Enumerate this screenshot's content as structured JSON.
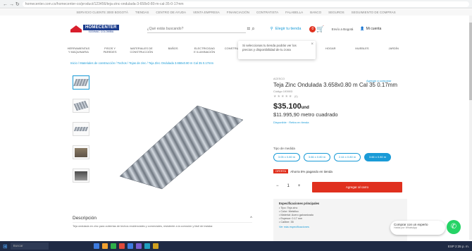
{
  "browser": {
    "url": "homecenter.com.co/homecenter-co/product/123456/teja-zinc-ondulada-3-658x0-80-m-cal-35-0-17mm",
    "nav_icons": "← → ↻"
  },
  "topstrip": {
    "items": [
      "SERVICIO CLIENTE 3000 BOGOTÁ",
      "TIENDAS",
      "CENTRO DE AYUDA",
      "VENTA EMPRESA",
      "FINANCIACIÓN",
      "CONTRATISTA",
      "FALABELLA",
      "BANCO",
      "SEGUROS",
      "SEGUIMIENTO DE COMPRAS"
    ]
  },
  "header": {
    "logo_brand": "HOMECENTER",
    "logo_sub": "SODIMAC COLOMBIA",
    "search_placeholder": "¿Qué estás buscando?",
    "store_label": "Elegir tu tienda",
    "cart_count": "0",
    "location": "Envío a Bogotá",
    "account_label": "Mi cuenta"
  },
  "tooltip": {
    "text": "Si seleccionas tu tienda podrás ver los precios y disponibilidad de tu zona",
    "close": "×"
  },
  "categories": [
    "HERRAMIENTAS Y MAQUINARIA",
    "PISOS Y PAREDES",
    "MATERIALES DE CONSTRUCCIÓN",
    "BAÑOS",
    "ELECTRICIDAD E ILUMINACIÓN",
    "CONSTRUCCIÓN",
    "DORMITORIO",
    "COCINA",
    "HOGAR",
    "MUEBLES",
    "JARDÍN",
    "DECORACIÓN"
  ],
  "breadcrumb": "Inicio / Materiales de construcción / Techos / Tejas de zinc / Teja Zinc Ondulada 3.658x0.80 m Cal 35 0.17mm",
  "product": {
    "brand": "ACESCO",
    "title": "Teja Zinc Ondulada 3.658x0.80 m Cal 35 0.17mm",
    "code": "Código 193903",
    "stars": "★★★★★",
    "review_count": "(0)",
    "price": "$35.100",
    "price_unit": "und",
    "price_m2": "$11.995,90 metro cuadrado",
    "availability": "Disponible · Retira en tienda",
    "compare": "Agregar a comparar"
  },
  "measures": {
    "label": "Tipo de medida",
    "options": [
      "3.05 x 0.80 m",
      "3.66 x 0.80 m",
      "2.44 x 0.80 m",
      "3.66 x 0.80 m"
    ],
    "selected_index": 3
  },
  "promo": {
    "badge": "OFERTA",
    "text": "Ahorra 5% pagando en tienda"
  },
  "quantity": {
    "minus": "−",
    "value": "1",
    "plus": "+"
  },
  "add_to_cart": "Agregar al carro",
  "specs": {
    "title": "Especificaciones principales",
    "items": [
      "Tipo: Teja zinc",
      "Color: Metálico",
      "Material: Acero galvanizado",
      "Espesor: 0.17 mm",
      "Calibre: 35"
    ],
    "more": "Ver más especificaciones"
  },
  "description": {
    "heading": "Descripción",
    "chevron": "^",
    "text": "Teja ondulada en zinc para cubiertas de techos residenciales y comerciales, resistente a la corrosión y fácil de instalar."
  },
  "chat": {
    "line1": "Comprar con un experto",
    "line2": "Habla por WhatsApp",
    "icon": "whatsapp-icon"
  },
  "taskbar": {
    "search": "Buscar",
    "tray": "ESP  2:35 p. m."
  }
}
